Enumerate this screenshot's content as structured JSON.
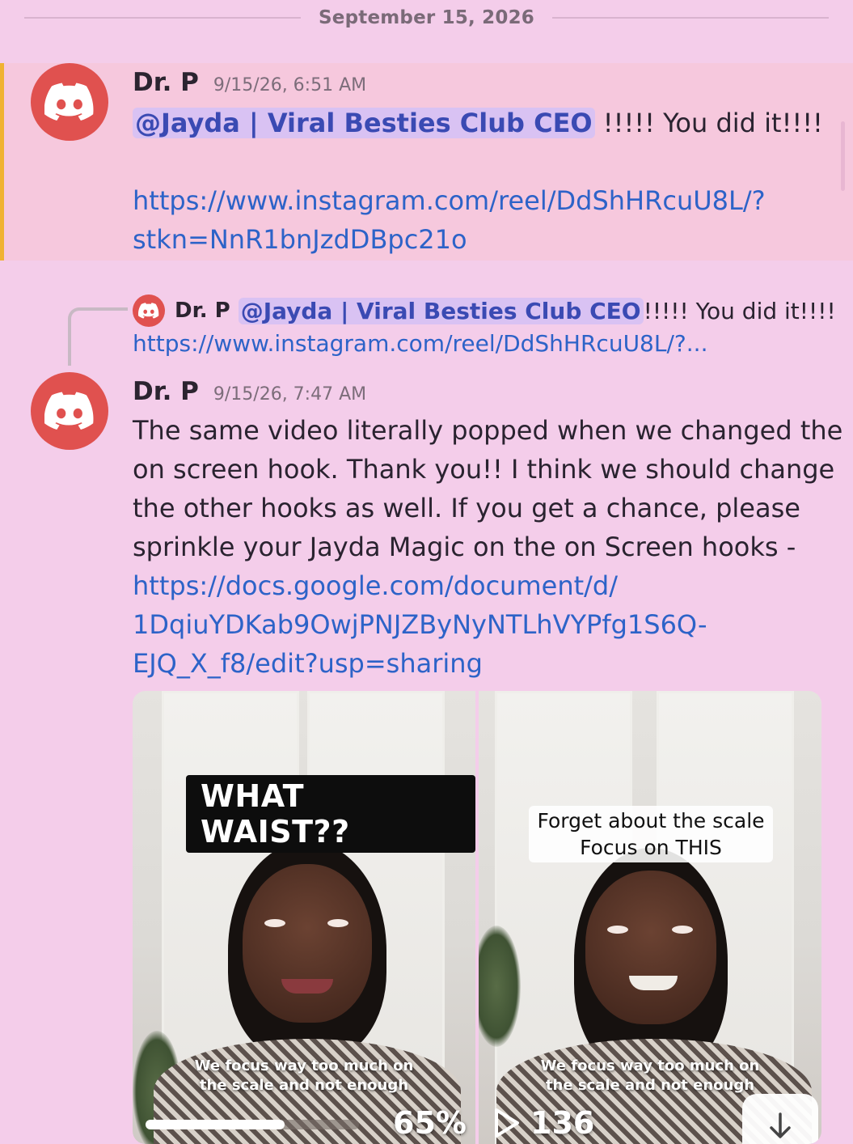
{
  "date_divider": "September 15, 2026",
  "messages": [
    {
      "author": "Dr. P",
      "timestamp": "9/15/26, 6:51 AM",
      "mention": "@Jayda | Viral Besties Club CEO",
      "text": " !!!!! You did it!!!!",
      "link_line1": "https://www.instagram.com/reel/DdShHRcuU8L/?",
      "link_line2": "stkn=NnR1bnJzdDBpc21o",
      "highlight_color": "#f0b232"
    },
    {
      "reply_preview": {
        "author": "Dr. P",
        "mention": "@Jayda | Viral Besties Club CEO",
        "text": " !!!!! You did it!!!!",
        "link": "https://www.instagram.com/reel/DdShHRcuU8L/?..."
      },
      "author": "Dr. P",
      "timestamp": "9/15/26, 7:47 AM",
      "text_lines": [
        "The same video literally popped when we changed the",
        "on screen hook. Thank you!! I think we should change",
        "the other hooks as well. If you get a chance, please",
        "sprinkle your Jayda Magic on the on Screen hooks -"
      ],
      "link_lines": [
        "https://docs.google.com/document/d/",
        "1DqiuYDKab9OwjPNJZByNyNTLhVYPfg1S6Q-",
        "EJQ_X_f8/edit?usp=sharing"
      ],
      "attachments": [
        {
          "hook_text": "WHAT WAIST??",
          "caption_lines": [
            "We focus way too much on",
            "the scale and not enough"
          ],
          "progress_percent": 65,
          "progress_label": "65%"
        },
        {
          "hook_lines": [
            "Forget about the scale",
            "Focus on THIS"
          ],
          "caption_lines": [
            "We focus way too much on",
            "the scale and not enough"
          ],
          "play_count": "136",
          "icons": [
            "play-icon",
            "download-icon"
          ]
        }
      ]
    }
  ],
  "colors": {
    "background": "#f4cdea",
    "highlight_band": "#f6c8dd",
    "avatar": "#e0514f",
    "link": "#2d63c8",
    "mention_bg": "#d9c2f3",
    "mention_text": "#3a4ab3"
  }
}
